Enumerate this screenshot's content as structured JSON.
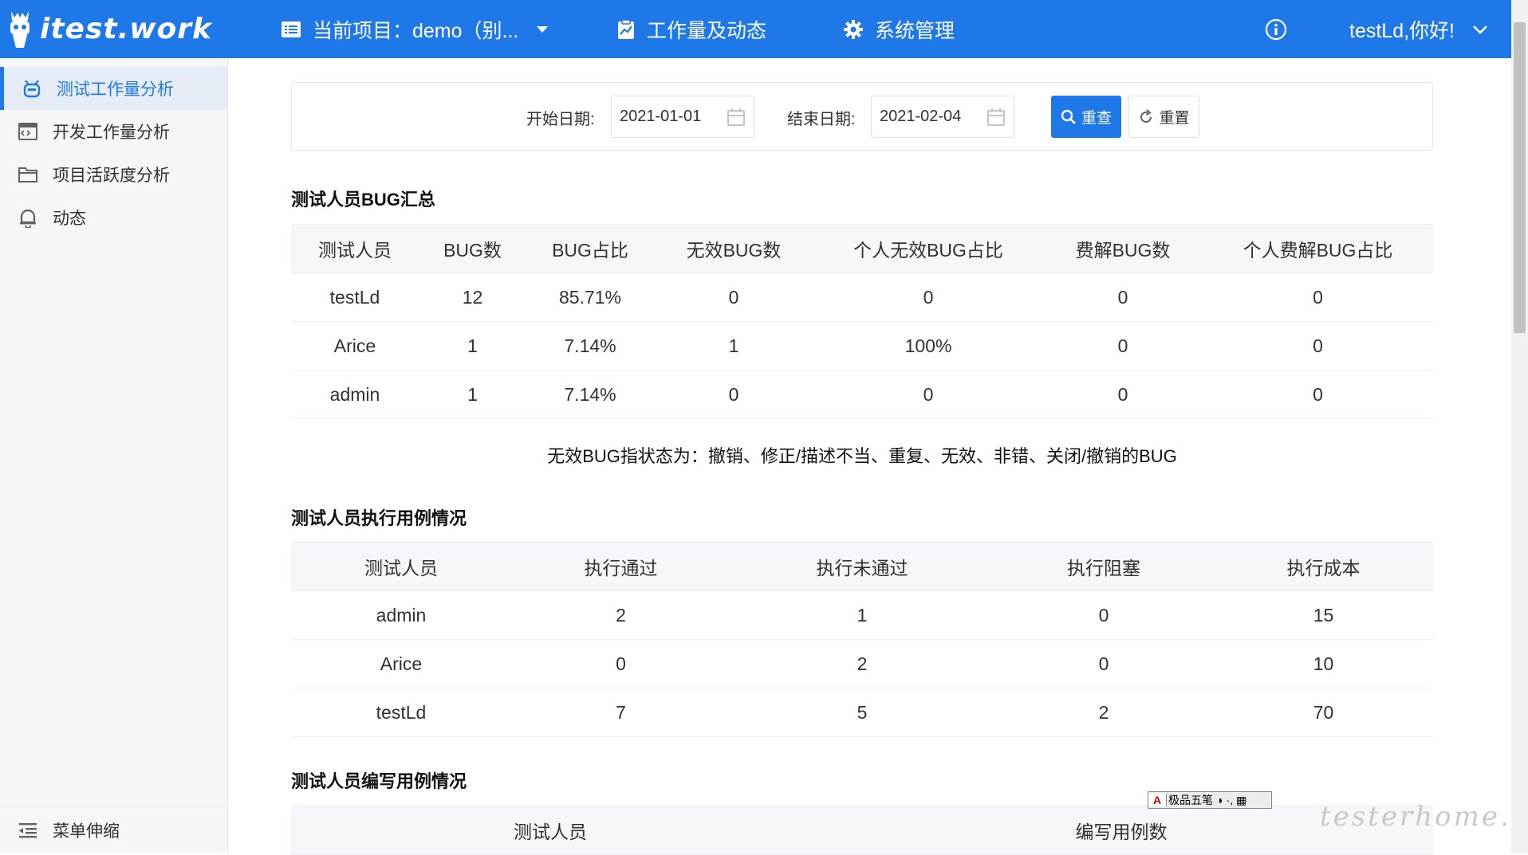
{
  "header": {
    "logo_text": "itest.work",
    "project_label": "当前项目：demo（别...",
    "workload_label": "工作量及动态",
    "system_label": "系统管理",
    "user_greeting": "testLd,你好!"
  },
  "sidebar": {
    "items": [
      {
        "label": "测试工作量分析",
        "active": true
      },
      {
        "label": "开发工作量分析"
      },
      {
        "label": "项目活跃度分析"
      },
      {
        "label": "动态"
      }
    ],
    "collapse_label": "菜单伸缩"
  },
  "filter": {
    "start_label": "开始日期:",
    "start_value": "2021-01-01",
    "end_label": "结束日期:",
    "end_value": "2021-02-04",
    "search_label": "重查",
    "reset_label": "重置"
  },
  "bug_summary": {
    "title": "测试人员BUG汇总",
    "headers": [
      "测试人员",
      "BUG数",
      "BUG占比",
      "无效BUG数",
      "个人无效BUG占比",
      "费解BUG数",
      "个人费解BUG占比"
    ],
    "rows": [
      [
        "testLd",
        "12",
        "85.71%",
        "0",
        "0",
        "0",
        "0"
      ],
      [
        "Arice",
        "1",
        "7.14%",
        "1",
        "100%",
        "0",
        "0"
      ],
      [
        "admin",
        "1",
        "7.14%",
        "0",
        "0",
        "0",
        "0"
      ]
    ],
    "note": "无效BUG指状态为：撤销、修正/描述不当、重复、无效、非错、关闭/撤销的BUG"
  },
  "exec_summary": {
    "title": "测试人员执行用例情况",
    "headers": [
      "测试人员",
      "执行通过",
      "执行未通过",
      "执行阻塞",
      "执行成本"
    ],
    "rows": [
      [
        "admin",
        "2",
        "1",
        "0",
        "15"
      ],
      [
        "Arice",
        "0",
        "2",
        "0",
        "10"
      ],
      [
        "testLd",
        "7",
        "5",
        "2",
        "70"
      ]
    ]
  },
  "write_summary": {
    "title": "测试人员编写用例情况",
    "headers": [
      "测试人员",
      "编写用例数"
    ]
  },
  "ime": {
    "a": "A",
    "name": "极品五笔",
    "s1": "◑",
    "s2": "·,",
    "s3": "▦"
  },
  "watermark": "testerhome.com",
  "colors": {
    "brand": "#1e78e8",
    "sidebar_bg": "#f5f6f8",
    "table_header_bg": "#f5f7fa"
  }
}
